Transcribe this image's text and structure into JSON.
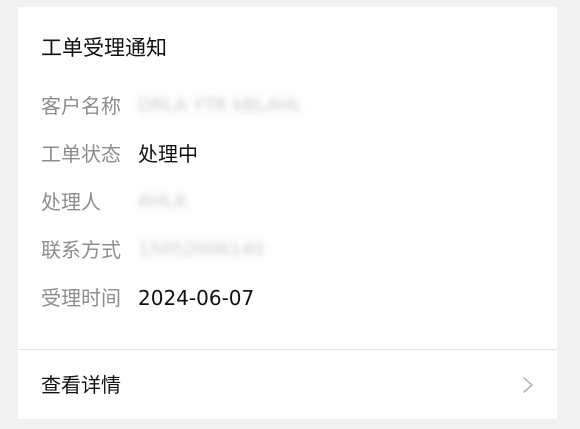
{
  "card": {
    "title": "工单受理通知",
    "fields": [
      {
        "label": "客户名称",
        "value": "DRLA YTR  kBLAHL",
        "blurred": true
      },
      {
        "label": "工单状态",
        "value": "处理中",
        "blurred": false
      },
      {
        "label": "处理人",
        "value": "AHLA",
        "blurred": true
      },
      {
        "label": "联系方式",
        "value": "15052006140",
        "blurred": true
      },
      {
        "label": "受理时间",
        "value": "2024-06-07",
        "blurred": false
      }
    ],
    "detail_link": {
      "label": "查看详情",
      "icon": "chevron-right-icon"
    }
  }
}
